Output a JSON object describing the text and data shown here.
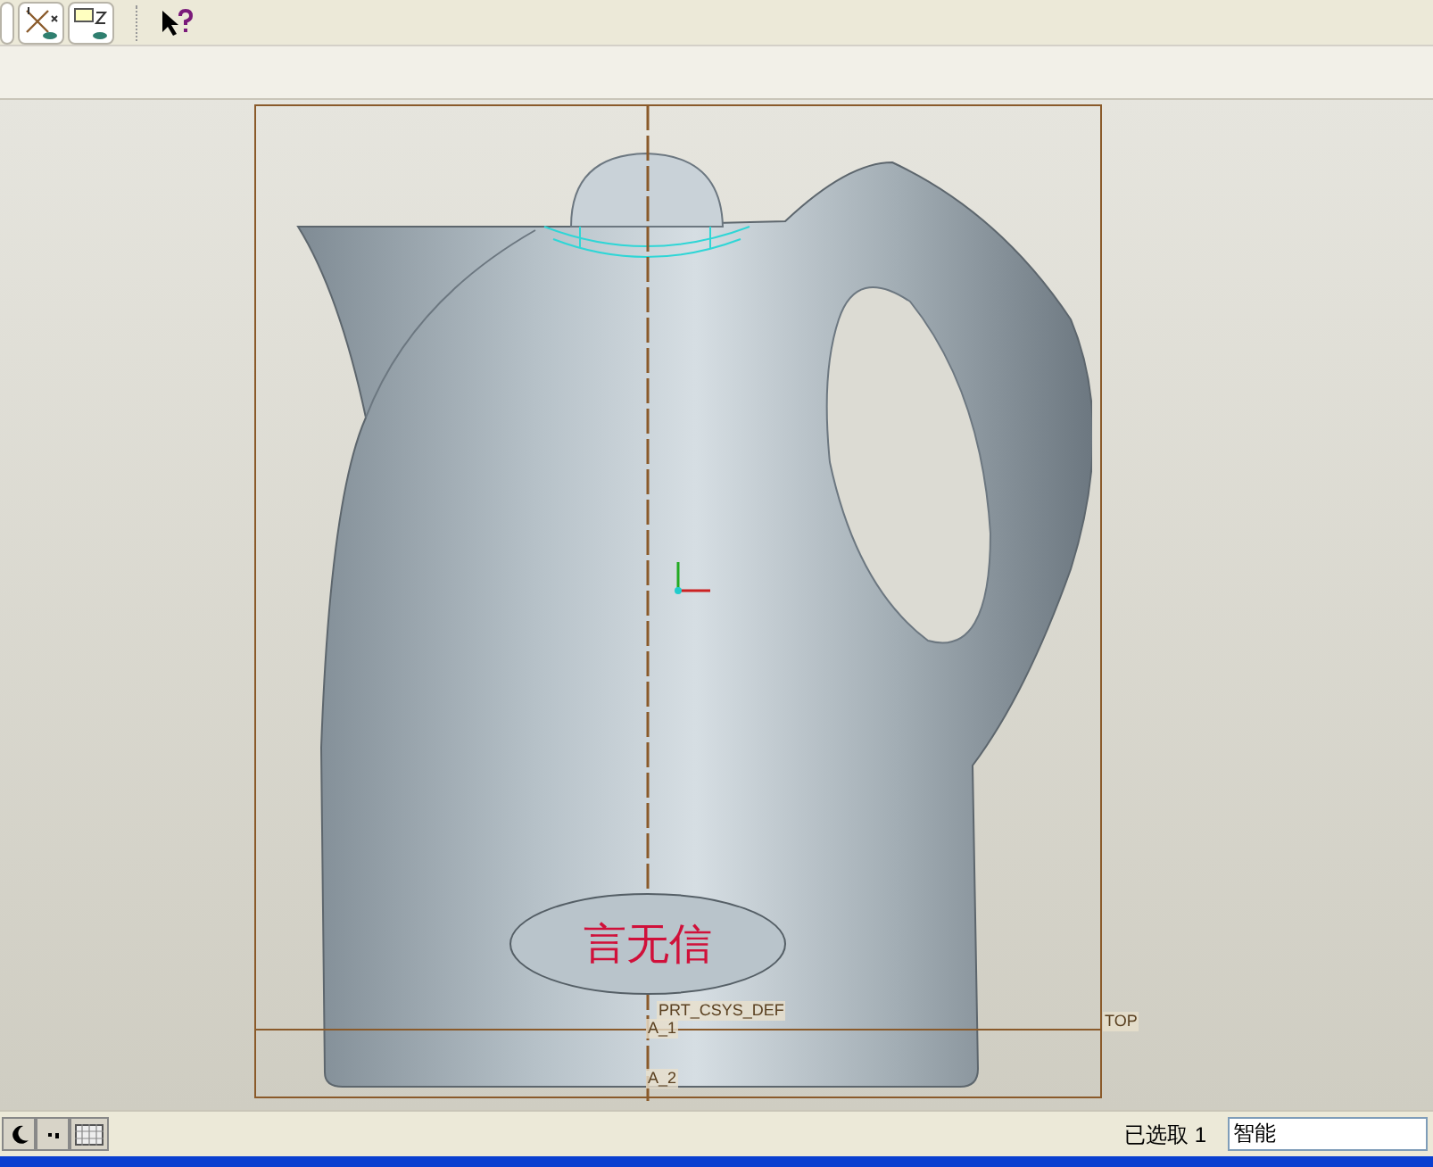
{
  "viewport": {
    "model_text": "言无信",
    "datum_labels": [
      {
        "kind": "csys",
        "text": "PRT_CSYS_DEF"
      },
      {
        "kind": "axis_top",
        "text": "A_1"
      },
      {
        "kind": "axis_bottom",
        "text": "A_2"
      },
      {
        "kind": "plane",
        "text": "TOP"
      }
    ]
  },
  "status_bar": {
    "selection": "已选取 1",
    "filter": "智能"
  }
}
